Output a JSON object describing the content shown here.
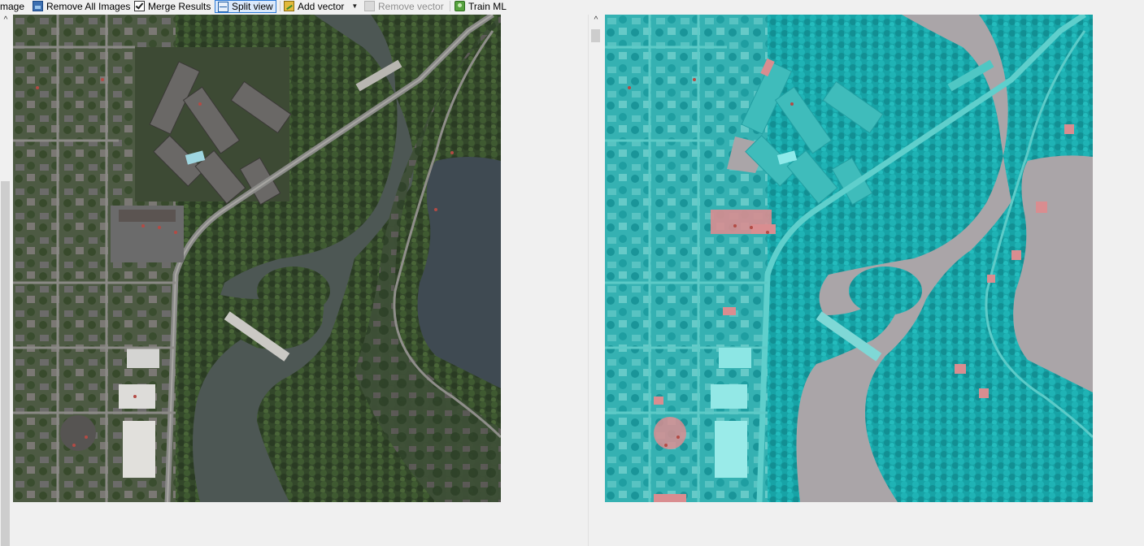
{
  "toolbar": {
    "image_partial": "mage",
    "remove_all_images": "Remove All Images",
    "merge_results": "Merge Results",
    "split_view": "Split view",
    "add_vector": "Add vector",
    "remove_vector": "Remove vector",
    "train_ml": "Train ML"
  },
  "left_pane": {
    "title": "",
    "image_kind": "aerial-orthophoto"
  },
  "right_pane": {
    "image_kind": "segmentation-overlay",
    "overlay_colors": {
      "vegetation": "#14b5b8",
      "water": "#a8a3a6",
      "building": "#e08c8e",
      "road": "#60c8c6"
    }
  },
  "colors": {
    "accent": "#2b7ad6",
    "toolbar_bg": "#f0f0f0"
  },
  "icons": {
    "remove_all_images": "image-stack-icon",
    "merge_results": "checkbox-checked-icon",
    "split_view": "split-view-icon",
    "add_vector": "add-vector-icon",
    "remove_vector": "remove-vector-icon",
    "train_ml": "train-ml-icon"
  }
}
